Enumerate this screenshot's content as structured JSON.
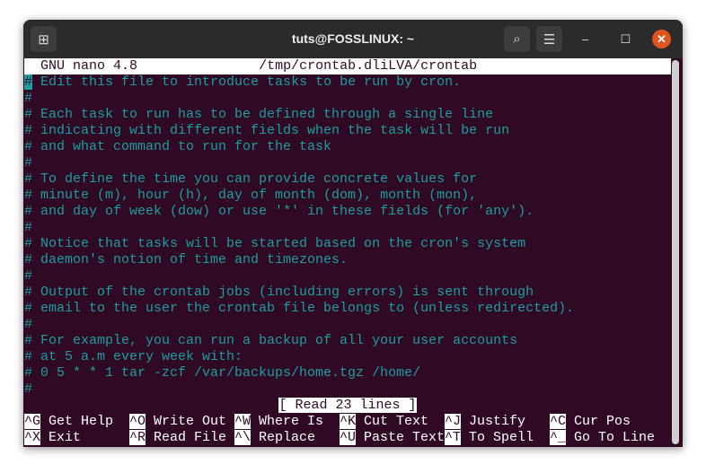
{
  "window": {
    "title": "tuts@FOSSLINUX: ~",
    "new_tab_icon": "new-tab-icon",
    "search_icon": "search-icon",
    "menu_icon": "hamburger-menu-icon"
  },
  "nano": {
    "version": "GNU nano 4.8",
    "file": "/tmp/crontab.dliLVA/crontab"
  },
  "lines": [
    "# Edit this file to introduce tasks to be run by cron.",
    "#",
    "# Each task to run has to be defined through a single line",
    "# indicating with different fields when the task will be run",
    "# and what command to run for the task",
    "#",
    "# To define the time you can provide concrete values for",
    "# minute (m), hour (h), day of month (dom), month (mon),",
    "# and day of week (dow) or use '*' in these fields (for 'any').",
    "#",
    "# Notice that tasks will be started based on the cron's system",
    "# daemon's notion of time and timezones.",
    "#",
    "# Output of the crontab jobs (including errors) is sent through",
    "# email to the user the crontab file belongs to (unless redirected).",
    "#",
    "# For example, you can run a backup of all your user accounts",
    "# at 5 a.m every week with:",
    "# 0 5 * * 1 tar -zcf /var/backups/home.tgz /home/",
    "#"
  ],
  "status": "[ Read 23 lines ]",
  "shortcuts": [
    [
      {
        "key": "^G",
        "label": " Get Help"
      },
      {
        "key": "^O",
        "label": " Write Out"
      },
      {
        "key": "^W",
        "label": " Where Is"
      },
      {
        "key": "^K",
        "label": " Cut Text"
      },
      {
        "key": "^J",
        "label": " Justify"
      },
      {
        "key": "^C",
        "label": " Cur Pos"
      }
    ],
    [
      {
        "key": "^X",
        "label": " Exit"
      },
      {
        "key": "^R",
        "label": " Read File"
      },
      {
        "key": "^\\",
        "label": " Replace"
      },
      {
        "key": "^U",
        "label": " Paste Text"
      },
      {
        "key": "^T",
        "label": " To Spell"
      },
      {
        "key": "^_",
        "label": " Go To Line"
      }
    ]
  ],
  "colors": {
    "background": "#300a24",
    "text": "#1a9ea1",
    "close": "#e0541f"
  }
}
